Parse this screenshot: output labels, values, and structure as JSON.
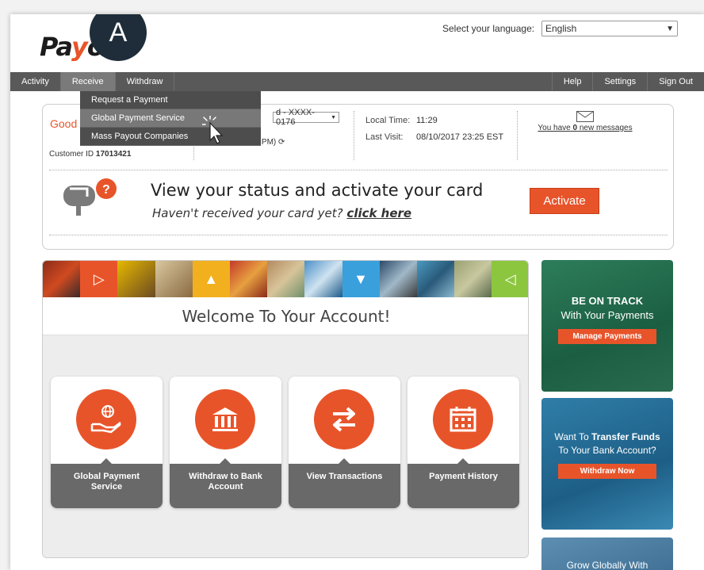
{
  "header": {
    "logo_text_a": "Pa",
    "logo_text_b": "y",
    "logo_text_c": "o",
    "logo_text_d": "r",
    "badge": "A",
    "language_label": "Select your language:",
    "language_value": "English"
  },
  "nav": {
    "left": [
      "Activity",
      "Receive",
      "Withdraw"
    ],
    "right": [
      "Help",
      "Settings",
      "Sign Out"
    ],
    "active": "Receive"
  },
  "dropdown": {
    "items": [
      "Request a Payment",
      "Global Payment Service",
      "Mass Payout Companies"
    ],
    "hovered": "Global Payment Service"
  },
  "account": {
    "greeting": "Good m",
    "customer_id_label": "Customer ID",
    "customer_id": "17013421",
    "card_select": "d - XXXX-0176",
    "refresh_text": "42 PM)",
    "local_time_label": "Local Time:",
    "local_time": "11:29",
    "last_visit_label": "Last Visit:",
    "last_visit": "08/10/2017 23:25 EST",
    "messages_prefix": "You have",
    "messages_count": "0",
    "messages_suffix": "new messages"
  },
  "promo": {
    "title": "View your status and activate your card",
    "subtitle": "Haven't received your card yet?",
    "link": "click here",
    "button": "Activate"
  },
  "main": {
    "welcome": "Welcome To Your Account!",
    "tiles": [
      {
        "label_1": "Global Payment",
        "label_2": "Service"
      },
      {
        "label_1": "Withdraw to Bank",
        "label_2": "Account"
      },
      {
        "label_1": "View Transactions",
        "label_2": ""
      },
      {
        "label_1": "Payment History",
        "label_2": ""
      }
    ]
  },
  "ads": {
    "ad1_line1": "BE ON TRACK",
    "ad1_line2": "With Your Payments",
    "ad1_button": "Manage Payments",
    "ad2_line1a": "Want To ",
    "ad2_line1b": "Transfer Funds",
    "ad2_line2": "To Your Bank Account?",
    "ad2_button": "Withdraw Now",
    "ad3_line": "Grow Globally With"
  },
  "colors": {
    "accent": "#e8542a",
    "nav": "#595959",
    "tile_label": "#696969"
  }
}
